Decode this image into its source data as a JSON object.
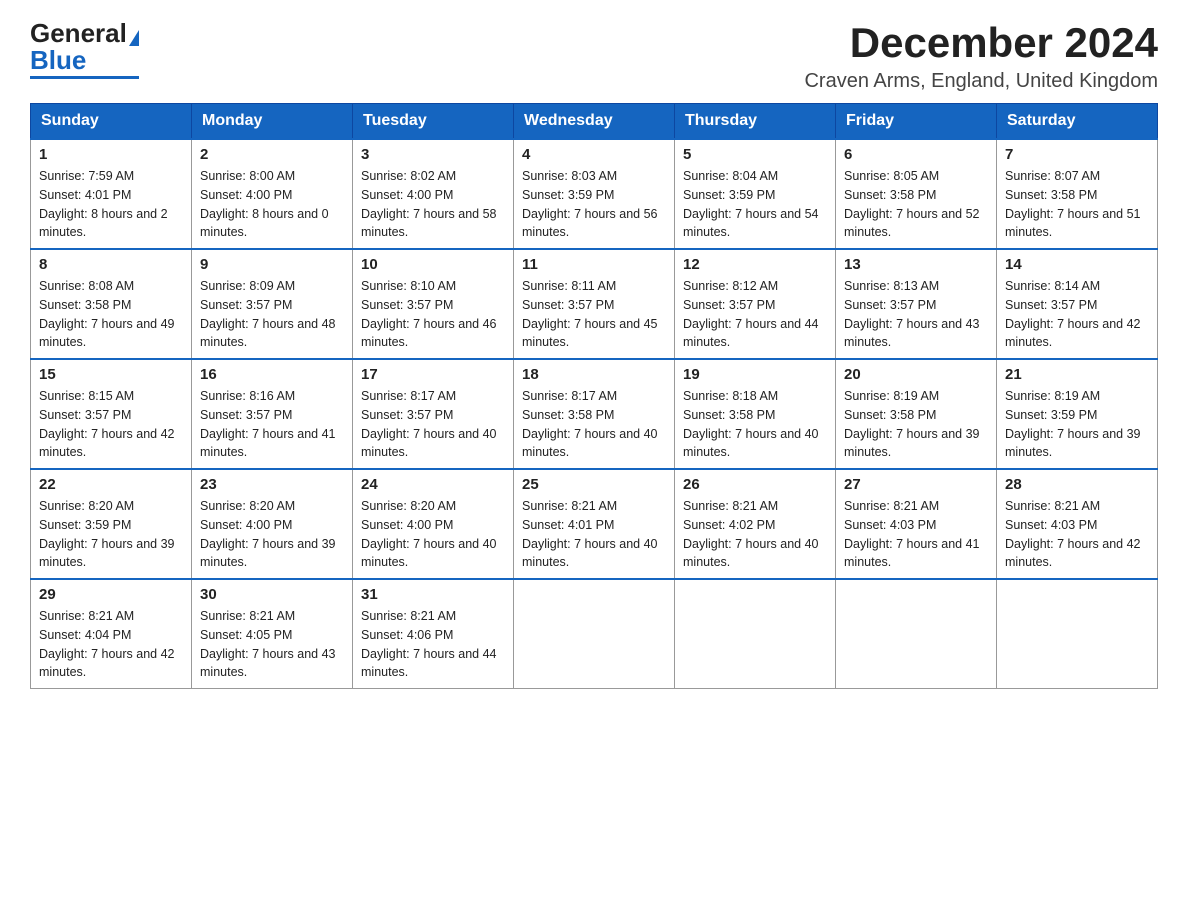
{
  "logo": {
    "general": "General",
    "blue": "Blue",
    "triangle": "▶"
  },
  "title": "December 2024",
  "subtitle": "Craven Arms, England, United Kingdom",
  "headers": [
    "Sunday",
    "Monday",
    "Tuesday",
    "Wednesday",
    "Thursday",
    "Friday",
    "Saturday"
  ],
  "weeks": [
    [
      {
        "day": "1",
        "sunrise": "7:59 AM",
        "sunset": "4:01 PM",
        "daylight": "8 hours and 2 minutes."
      },
      {
        "day": "2",
        "sunrise": "8:00 AM",
        "sunset": "4:00 PM",
        "daylight": "8 hours and 0 minutes."
      },
      {
        "day": "3",
        "sunrise": "8:02 AM",
        "sunset": "4:00 PM",
        "daylight": "7 hours and 58 minutes."
      },
      {
        "day": "4",
        "sunrise": "8:03 AM",
        "sunset": "3:59 PM",
        "daylight": "7 hours and 56 minutes."
      },
      {
        "day": "5",
        "sunrise": "8:04 AM",
        "sunset": "3:59 PM",
        "daylight": "7 hours and 54 minutes."
      },
      {
        "day": "6",
        "sunrise": "8:05 AM",
        "sunset": "3:58 PM",
        "daylight": "7 hours and 52 minutes."
      },
      {
        "day": "7",
        "sunrise": "8:07 AM",
        "sunset": "3:58 PM",
        "daylight": "7 hours and 51 minutes."
      }
    ],
    [
      {
        "day": "8",
        "sunrise": "8:08 AM",
        "sunset": "3:58 PM",
        "daylight": "7 hours and 49 minutes."
      },
      {
        "day": "9",
        "sunrise": "8:09 AM",
        "sunset": "3:57 PM",
        "daylight": "7 hours and 48 minutes."
      },
      {
        "day": "10",
        "sunrise": "8:10 AM",
        "sunset": "3:57 PM",
        "daylight": "7 hours and 46 minutes."
      },
      {
        "day": "11",
        "sunrise": "8:11 AM",
        "sunset": "3:57 PM",
        "daylight": "7 hours and 45 minutes."
      },
      {
        "day": "12",
        "sunrise": "8:12 AM",
        "sunset": "3:57 PM",
        "daylight": "7 hours and 44 minutes."
      },
      {
        "day": "13",
        "sunrise": "8:13 AM",
        "sunset": "3:57 PM",
        "daylight": "7 hours and 43 minutes."
      },
      {
        "day": "14",
        "sunrise": "8:14 AM",
        "sunset": "3:57 PM",
        "daylight": "7 hours and 42 minutes."
      }
    ],
    [
      {
        "day": "15",
        "sunrise": "8:15 AM",
        "sunset": "3:57 PM",
        "daylight": "7 hours and 42 minutes."
      },
      {
        "day": "16",
        "sunrise": "8:16 AM",
        "sunset": "3:57 PM",
        "daylight": "7 hours and 41 minutes."
      },
      {
        "day": "17",
        "sunrise": "8:17 AM",
        "sunset": "3:57 PM",
        "daylight": "7 hours and 40 minutes."
      },
      {
        "day": "18",
        "sunrise": "8:17 AM",
        "sunset": "3:58 PM",
        "daylight": "7 hours and 40 minutes."
      },
      {
        "day": "19",
        "sunrise": "8:18 AM",
        "sunset": "3:58 PM",
        "daylight": "7 hours and 40 minutes."
      },
      {
        "day": "20",
        "sunrise": "8:19 AM",
        "sunset": "3:58 PM",
        "daylight": "7 hours and 39 minutes."
      },
      {
        "day": "21",
        "sunrise": "8:19 AM",
        "sunset": "3:59 PM",
        "daylight": "7 hours and 39 minutes."
      }
    ],
    [
      {
        "day": "22",
        "sunrise": "8:20 AM",
        "sunset": "3:59 PM",
        "daylight": "7 hours and 39 minutes."
      },
      {
        "day": "23",
        "sunrise": "8:20 AM",
        "sunset": "4:00 PM",
        "daylight": "7 hours and 39 minutes."
      },
      {
        "day": "24",
        "sunrise": "8:20 AM",
        "sunset": "4:00 PM",
        "daylight": "7 hours and 40 minutes."
      },
      {
        "day": "25",
        "sunrise": "8:21 AM",
        "sunset": "4:01 PM",
        "daylight": "7 hours and 40 minutes."
      },
      {
        "day": "26",
        "sunrise": "8:21 AM",
        "sunset": "4:02 PM",
        "daylight": "7 hours and 40 minutes."
      },
      {
        "day": "27",
        "sunrise": "8:21 AM",
        "sunset": "4:03 PM",
        "daylight": "7 hours and 41 minutes."
      },
      {
        "day": "28",
        "sunrise": "8:21 AM",
        "sunset": "4:03 PM",
        "daylight": "7 hours and 42 minutes."
      }
    ],
    [
      {
        "day": "29",
        "sunrise": "8:21 AM",
        "sunset": "4:04 PM",
        "daylight": "7 hours and 42 minutes."
      },
      {
        "day": "30",
        "sunrise": "8:21 AM",
        "sunset": "4:05 PM",
        "daylight": "7 hours and 43 minutes."
      },
      {
        "day": "31",
        "sunrise": "8:21 AM",
        "sunset": "4:06 PM",
        "daylight": "7 hours and 44 minutes."
      },
      null,
      null,
      null,
      null
    ]
  ]
}
